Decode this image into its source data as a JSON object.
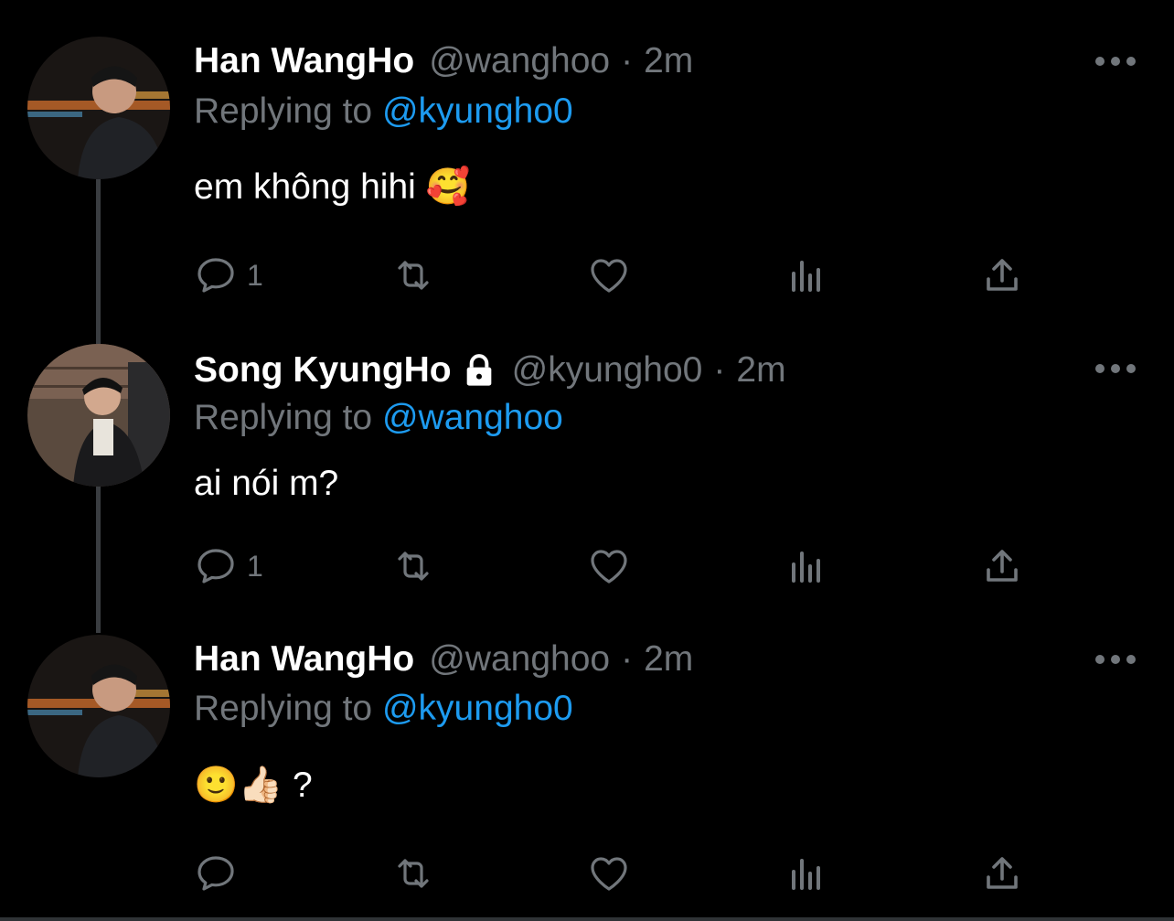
{
  "colors": {
    "background": "#000000",
    "name": "#ffffff",
    "secondary": "#71767b",
    "link": "#1d9bf0",
    "divider": "#2f3336"
  },
  "tweets": [
    {
      "name": "Han WangHo",
      "handle": "@wanghoo",
      "separator": "·",
      "time": "2m",
      "protected": false,
      "replying_label": "Replying to",
      "replying_to": "@kyungho0",
      "text": "em không hihi 🥰",
      "reply_count": "1",
      "avatar_icon": "avatar-photo"
    },
    {
      "name": "Song KyungHo",
      "handle": "@kyungho0",
      "separator": "·",
      "time": "2m",
      "protected": true,
      "replying_label": "Replying to",
      "replying_to": "@wanghoo",
      "text": "ai nói m?",
      "reply_count": "1",
      "avatar_icon": "avatar-photo"
    },
    {
      "name": "Han WangHo",
      "handle": "@wanghoo",
      "separator": "·",
      "time": "2m",
      "protected": false,
      "replying_label": "Replying to",
      "replying_to": "@kyungho0",
      "text": "🙂👍🏻 ?",
      "reply_count": "",
      "avatar_icon": "avatar-photo"
    }
  ],
  "icons": {
    "reply": "reply-icon",
    "retweet": "retweet-icon",
    "like": "like-icon",
    "views": "views-icon",
    "share": "share-icon",
    "more": "more-icon",
    "lock": "lock-icon"
  }
}
